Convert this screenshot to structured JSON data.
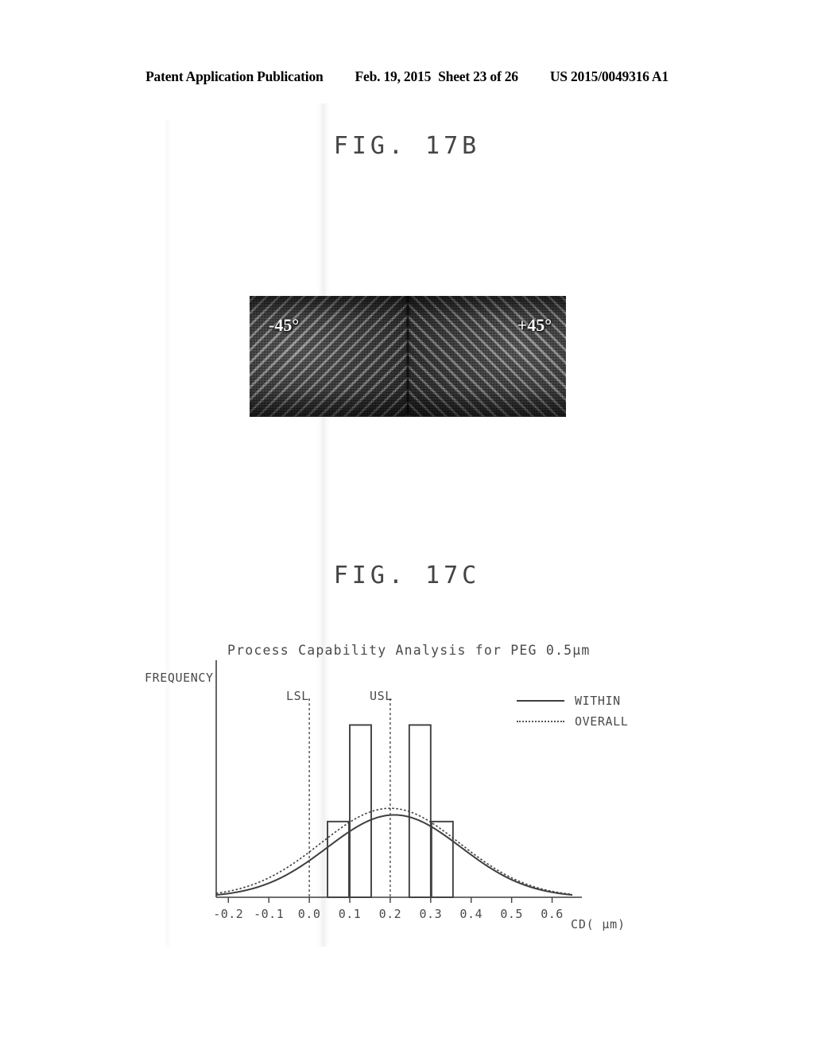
{
  "header": {
    "publication": "Patent Application Publication",
    "date": "Feb. 19, 2015",
    "sheet": "Sheet 23 of 26",
    "number": "US 2015/0049316 A1"
  },
  "figures": {
    "fig_b": {
      "title": "FIG. 17B",
      "label_left": "-45°",
      "label_right": "+45°"
    },
    "fig_c": {
      "title": "FIG. 17C"
    }
  },
  "chart_data": {
    "type": "bar",
    "title": "Process Capability Analysis for PEG 0.5μm",
    "xlabel": "CD( μm)",
    "ylabel": "FREQUENCY",
    "xlim": [
      -0.23,
      0.65
    ],
    "ylim": [
      0,
      10
    ],
    "grid": false,
    "xticks": [
      "-0.2",
      "-0.1",
      "0.0",
      "0.1",
      "0.2",
      "0.3",
      "0.4",
      "0.5",
      "0.6"
    ],
    "xtick_values": [
      -0.2,
      -0.1,
      0.0,
      0.1,
      0.2,
      0.3,
      0.4,
      0.5,
      0.6
    ],
    "bars": [
      {
        "x0": 0.045,
        "x1": 0.098,
        "height": 4.0
      },
      {
        "x0": 0.1,
        "x1": 0.153,
        "height": 9.1
      },
      {
        "x0": 0.247,
        "x1": 0.3,
        "height": 9.1
      },
      {
        "x0": 0.302,
        "x1": 0.355,
        "height": 4.0
      }
    ],
    "reference_lines": [
      {
        "label": "LSL",
        "value": 0.0
      },
      {
        "label": "USL",
        "value": 0.2
      }
    ],
    "series": [
      {
        "name": "WITHIN",
        "style": "solid",
        "mean": 0.21,
        "sigma": 0.165,
        "peak": 4.35
      },
      {
        "name": "OVERALL",
        "style": "dotted",
        "mean": 0.2,
        "sigma": 0.172,
        "peak": 4.7
      }
    ],
    "legend": [
      {
        "label": "WITHIN",
        "style": "solid"
      },
      {
        "label": "OVERALL",
        "style": "dotted"
      }
    ],
    "legend_position": "top-right"
  }
}
